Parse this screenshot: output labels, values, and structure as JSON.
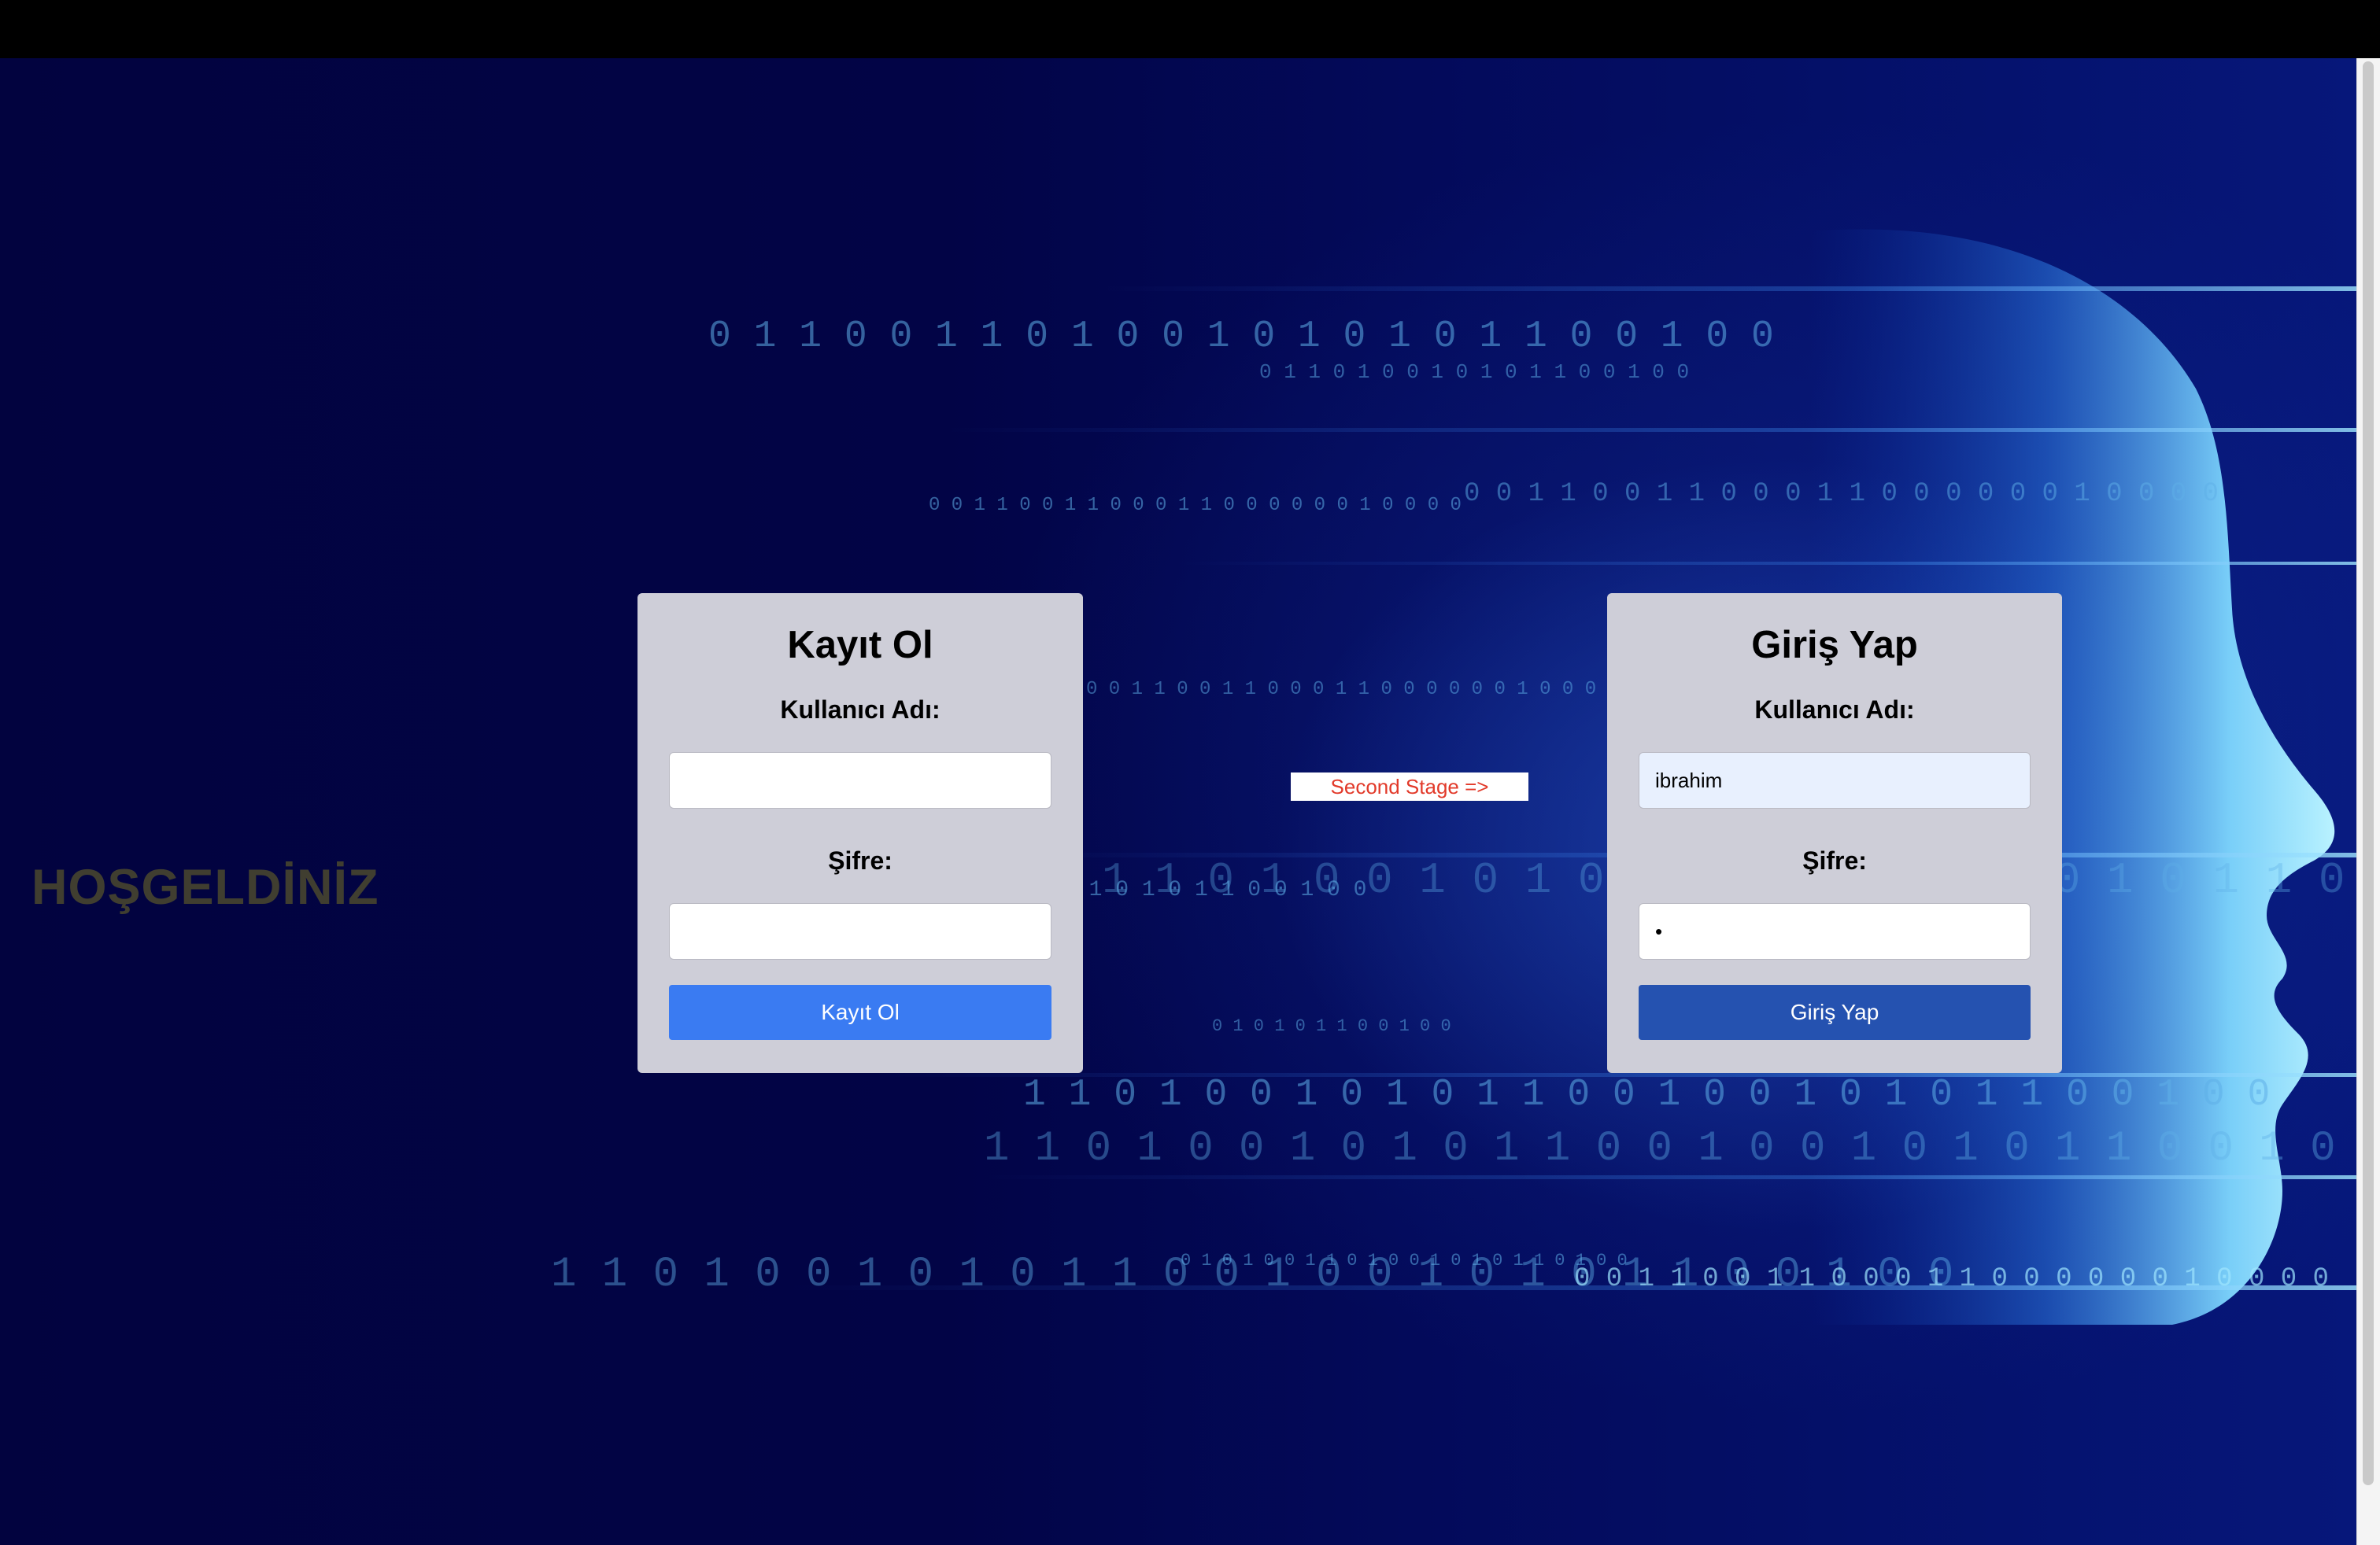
{
  "page": {
    "welcome_text": "HOŞGELDİNİZ",
    "second_stage_link": "Second Stage =>"
  },
  "register": {
    "title": "Kayıt Ol",
    "username_label": "Kullanıcı Adı:",
    "username_value": "",
    "password_label": "Şifre:",
    "password_value": "",
    "button_label": "Kayıt Ol"
  },
  "login": {
    "title": "Giriş Yap",
    "username_label": "Kullanıcı Adı:",
    "username_value": "ibrahim",
    "password_label": "Şifre:",
    "password_value": "•",
    "button_label": "Giriş Yap"
  },
  "background": {
    "binary_rows": [
      "0 1 1 0 0 1 1 0 1 0 0 1 0 1 0 1 0 1 1 0 0 1 0 0",
      "0 1 1 0 1 0 0 1 0 1 0 1 1 0 0 1 0 0",
      "0 0 1 1 0 0 1 1 0 0 0 1 1 0 0 0 0 0 0 1 0 0 0 0",
      "0 1 0 1 0 1 1 0 0 1 0 0",
      "1 1 0 1 0 0 1 0 1 0 1 1 0 0 1 0 0 1 0 1 0 1 1 0 0 1 0 0",
      "0 1 0 1 0 0 1 1 0 1 0 0 1 0 1 0 1 1 0 1 0 0"
    ],
    "colors": {
      "bg_dark": "#02033f",
      "glow": "#7fd8ff",
      "digits": "#5fb0e8"
    }
  }
}
